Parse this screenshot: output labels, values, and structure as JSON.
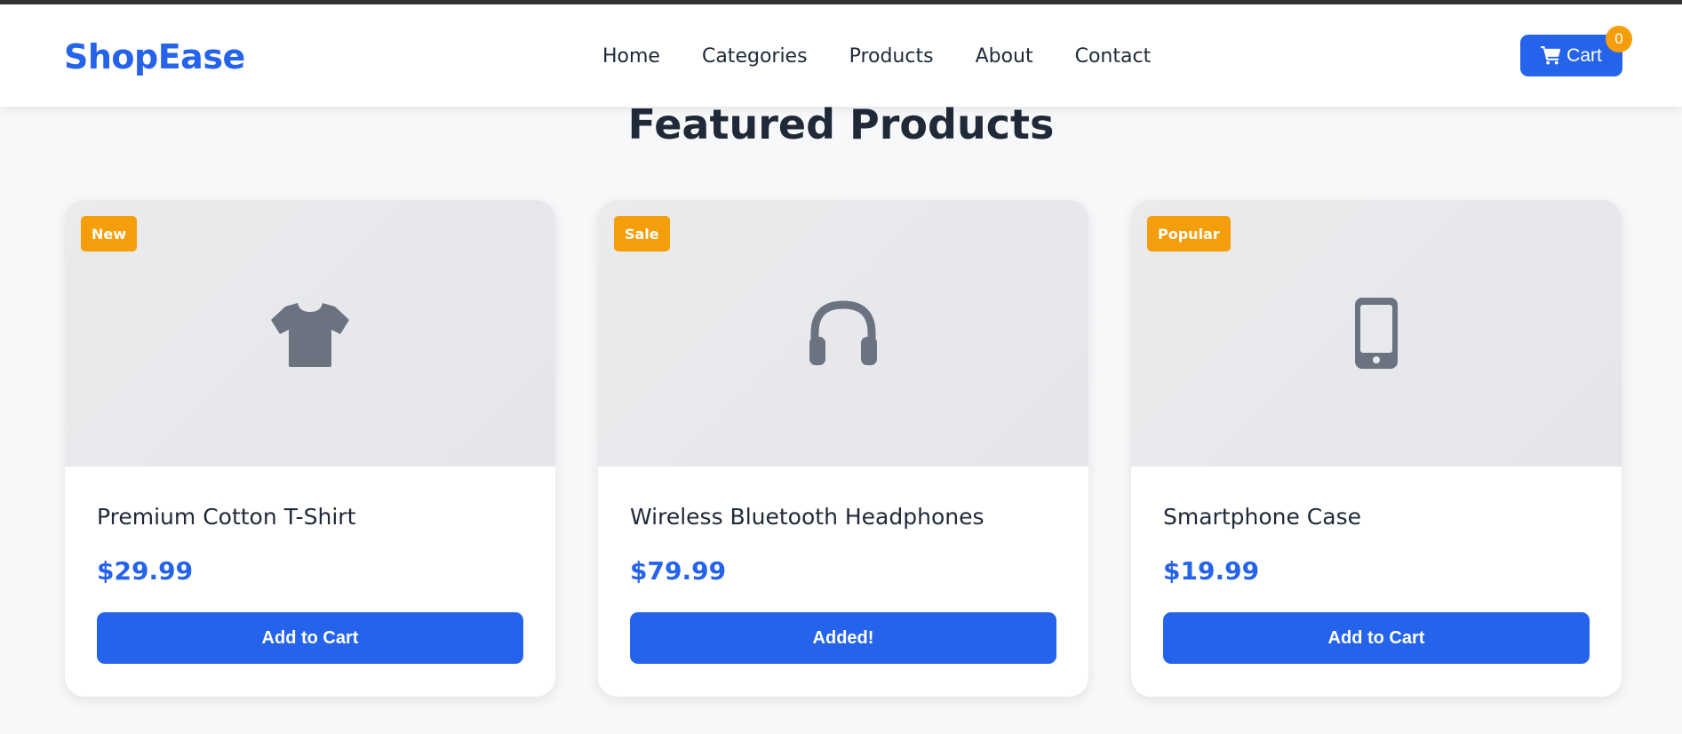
{
  "header": {
    "logo": "ShopEase",
    "nav": [
      "Home",
      "Categories",
      "Products",
      "About",
      "Contact"
    ],
    "cart_label": "Cart",
    "cart_count": "0"
  },
  "main": {
    "title": "Featured Products",
    "products": [
      {
        "badge": "New",
        "icon": "tshirt-icon",
        "name": "Premium Cotton T-Shirt",
        "price": "$29.99",
        "button": "Add to Cart"
      },
      {
        "badge": "Sale",
        "icon": "headphones-icon",
        "name": "Wireless Bluetooth Headphones",
        "price": "$79.99",
        "button": "Added!"
      },
      {
        "badge": "Popular",
        "icon": "smartphone-icon",
        "name": "Smartphone Case",
        "price": "$19.99",
        "button": "Add to Cart"
      }
    ]
  },
  "colors": {
    "brand": "#2563eb",
    "badge": "#f59e0b",
    "icon": "#6b7280"
  }
}
